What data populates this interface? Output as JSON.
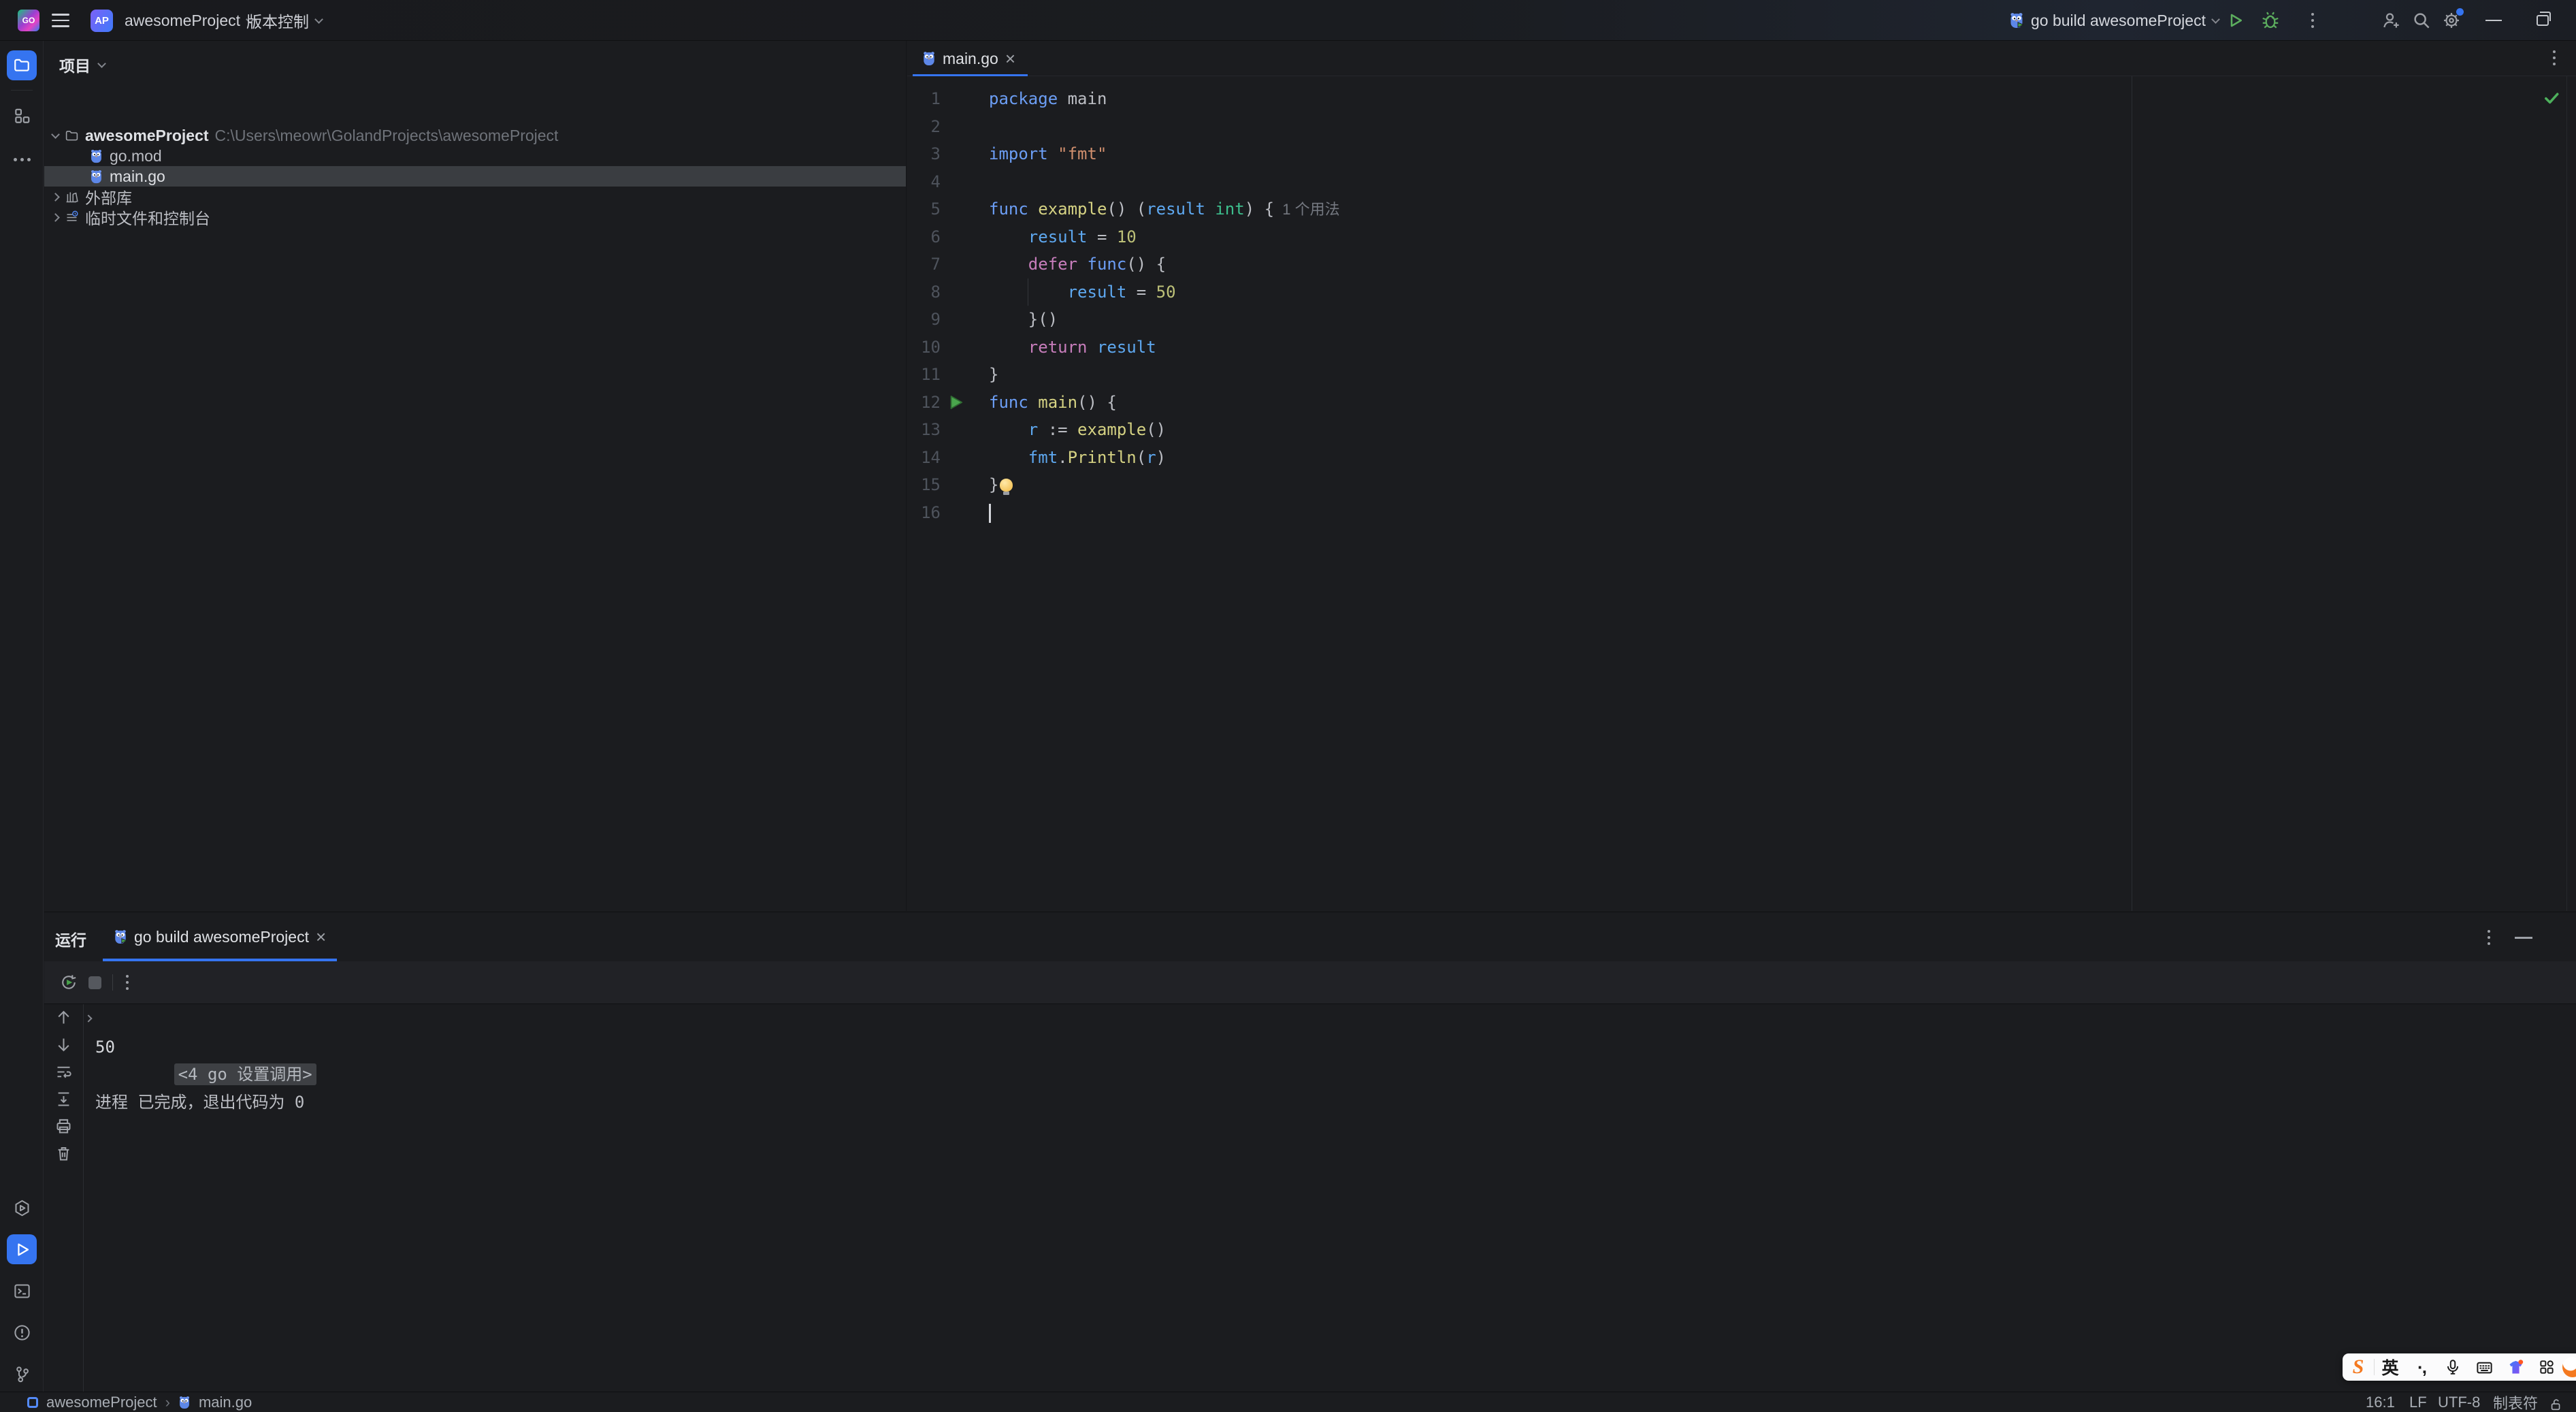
{
  "palette": {
    "accent": "#3574F0",
    "run_green": "#5CAD5E",
    "check_green": "#4DB05C",
    "bulb_yellow": "#F0B73F",
    "ime_orange": "#F4791F"
  },
  "title_bar": {
    "logo": "GO",
    "project_badge": "AP",
    "project_name": "awesomeProject",
    "vcs_label": "版本控制",
    "run_config_label": "go build awesomeProject"
  },
  "project_panel": {
    "title": "项目",
    "tree": [
      {
        "label": "awesomeProject",
        "detail": "C:\\Users\\meowr\\GolandProjects\\awesomeProject"
      },
      {
        "label": "go.mod"
      },
      {
        "label": "main.go"
      },
      {
        "label": "外部库"
      },
      {
        "label": "临时文件和控制台"
      }
    ]
  },
  "editor": {
    "tab": "main.go",
    "close_glyph": "×",
    "lines": [
      {
        "n": 1,
        "t": [
          [
            "k",
            "package"
          ],
          [
            "w",
            " main"
          ]
        ]
      },
      {
        "n": 2,
        "t": []
      },
      {
        "n": 3,
        "t": [
          [
            "k",
            "import"
          ],
          [
            "w",
            " "
          ],
          [
            "s",
            "\"fmt\""
          ]
        ]
      },
      {
        "n": 4,
        "t": []
      },
      {
        "n": 5,
        "t": [
          [
            "k",
            "func"
          ],
          [
            "w",
            " "
          ],
          [
            "f",
            "example"
          ],
          [
            "w",
            "() ("
          ],
          [
            "v",
            "result"
          ],
          [
            "w",
            " "
          ],
          [
            "t",
            "int"
          ],
          [
            "w",
            ") {"
          ],
          [
            "h",
            "  1 个用法"
          ]
        ]
      },
      {
        "n": 6,
        "t": [
          [
            "w",
            "    "
          ],
          [
            "v",
            "result"
          ],
          [
            "w",
            " = "
          ],
          [
            "n",
            "10"
          ]
        ]
      },
      {
        "n": 7,
        "t": [
          [
            "w",
            "    "
          ],
          [
            "p",
            "defer"
          ],
          [
            "w",
            " "
          ],
          [
            "k",
            "func"
          ],
          [
            "w",
            "() {"
          ]
        ]
      },
      {
        "n": 8,
        "guide": true,
        "t": [
          [
            "w",
            "        "
          ],
          [
            "v",
            "result"
          ],
          [
            "w",
            " = "
          ],
          [
            "n",
            "50"
          ]
        ]
      },
      {
        "n": 9,
        "t": [
          [
            "w",
            "    }()"
          ]
        ]
      },
      {
        "n": 10,
        "t": [
          [
            "w",
            "    "
          ],
          [
            "p",
            "return"
          ],
          [
            "w",
            " "
          ],
          [
            "v",
            "result"
          ]
        ]
      },
      {
        "n": 11,
        "t": [
          [
            "w",
            "}"
          ]
        ]
      },
      {
        "n": 12,
        "run": true,
        "t": [
          [
            "k",
            "func"
          ],
          [
            "w",
            " "
          ],
          [
            "f",
            "main"
          ],
          [
            "w",
            "() {"
          ]
        ]
      },
      {
        "n": 13,
        "t": [
          [
            "w",
            "    "
          ],
          [
            "v",
            "r"
          ],
          [
            "w",
            " := "
          ],
          [
            "f",
            "example"
          ],
          [
            "w",
            "()"
          ]
        ]
      },
      {
        "n": 14,
        "t": [
          [
            "w",
            "    "
          ],
          [
            "v",
            "fmt"
          ],
          [
            "w",
            "."
          ],
          [
            "f",
            "Println"
          ],
          [
            "w",
            "("
          ],
          [
            "v",
            "r"
          ],
          [
            "w",
            ")"
          ]
        ]
      },
      {
        "n": 15,
        "bulb": true,
        "t": [
          [
            "w",
            "}"
          ]
        ]
      },
      {
        "n": 16,
        "caret": true,
        "t": []
      }
    ]
  },
  "run_panel": {
    "title": "运行",
    "tab": "go build awesomeProject",
    "close_glyph": "×",
    "console": {
      "folded": "<4 go 设置调用>",
      "lines": [
        "50",
        "",
        "进程 已完成，退出代码为 0"
      ]
    }
  },
  "status_bar": {
    "project": "awesomeProject",
    "separator": "›",
    "file": "main.go",
    "caret": "16:1",
    "line_ending": "LF",
    "encoding": "UTF-8",
    "indent": "制表符"
  },
  "ime_bar": {
    "logo": "S",
    "mode": "英",
    "punct": "·,"
  }
}
